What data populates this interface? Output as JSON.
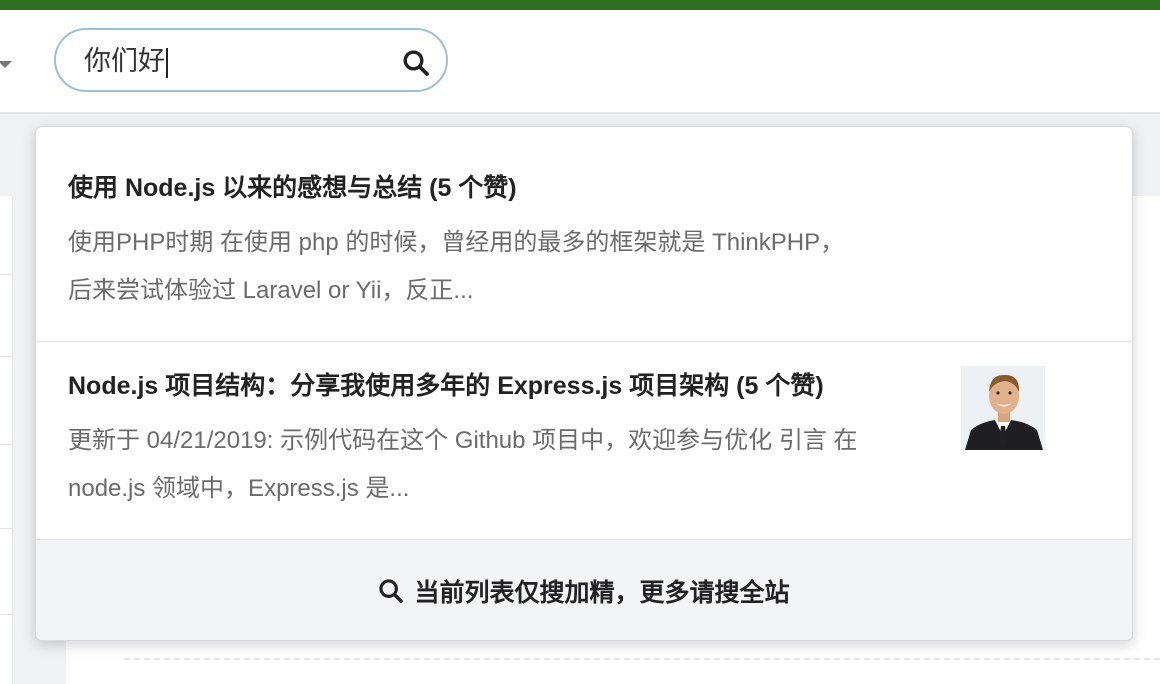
{
  "search": {
    "value": "你们好",
    "icon": "search-icon"
  },
  "results": [
    {
      "title": "使用 Node.js 以来的感想与总结 (5 个赞)",
      "excerpt_lines": [
        "使用PHP时期 在使用 php 的时候，曾经用的最多的框架就是 ThinkPHP，",
        "后来尝试体验过 Laravel or Yii，反正..."
      ]
    },
    {
      "title": "Node.js 项目结构：分享我使用多年的 Express.js 项目架构 (5 个赞)",
      "excerpt_lines": [
        "更新于 04/21/2019: 示例代码在这个 Github 项目中，欢迎参与优化 引言 在",
        "node.js 领域中，Express.js 是..."
      ],
      "thumbnail": "author-avatar"
    }
  ],
  "footer": {
    "label": "当前列表仅搜加精，更多请搜全站",
    "icon": "search-icon"
  },
  "colors": {
    "top_bar": "#2f6f1f",
    "search_border": "#9bbfd6",
    "title_text": "#222222",
    "excerpt_text": "#6b6b6b"
  }
}
